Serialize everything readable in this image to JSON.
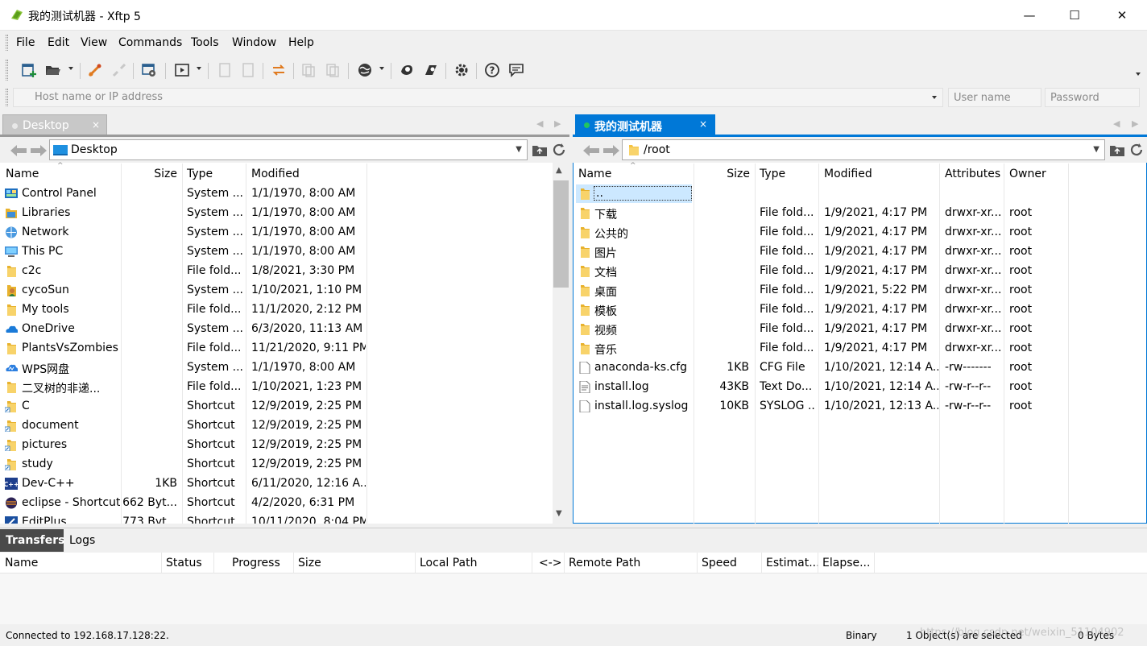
{
  "window": {
    "title": "我的测试机器  - Xftp 5",
    "minimize": "—",
    "maximize": "☐",
    "close": "✕"
  },
  "menu": [
    "File",
    "Edit",
    "View",
    "Commands",
    "Tools",
    "Window",
    "Help"
  ],
  "toolbar_icons": [
    "new-session-icon",
    "open-folder-icon",
    "connect-icon",
    "disconnect-icon",
    "session-properties-icon",
    "transfer-icon",
    "refresh-icon",
    "copy-icon",
    "sync-icon",
    "paste-icon",
    "paste-into-icon",
    "web-icon",
    "xshell-icon",
    "xftp-icon",
    "options-icon",
    "help-icon",
    "feedback-icon"
  ],
  "address": {
    "host_placeholder": "Host name or IP address",
    "user_placeholder": "User name",
    "password_placeholder": "Password"
  },
  "left_pane": {
    "tab": "Desktop",
    "tab_close": "×",
    "path": "Desktop",
    "columns": [
      "Name",
      "Size",
      "Type",
      "Modified"
    ],
    "files": [
      {
        "name": "Control Panel",
        "size": "",
        "type": "System ...",
        "modified": "1/1/1970, 8:00 AM",
        "icon": "control-panel"
      },
      {
        "name": "Libraries",
        "size": "",
        "type": "System ...",
        "modified": "1/1/1970, 8:00 AM",
        "icon": "libraries"
      },
      {
        "name": "Network",
        "size": "",
        "type": "System ...",
        "modified": "1/1/1970, 8:00 AM",
        "icon": "network"
      },
      {
        "name": "This PC",
        "size": "",
        "type": "System ...",
        "modified": "1/1/1970, 8:00 AM",
        "icon": "this-pc"
      },
      {
        "name": "c2c",
        "size": "",
        "type": "File fold...",
        "modified": "1/8/2021, 3:30 PM",
        "icon": "folder"
      },
      {
        "name": "cycoSun",
        "size": "",
        "type": "System ...",
        "modified": "1/10/2021, 1:10 PM",
        "icon": "user-folder"
      },
      {
        "name": "My tools",
        "size": "",
        "type": "File fold...",
        "modified": "11/1/2020, 2:12 PM",
        "icon": "folder"
      },
      {
        "name": "OneDrive",
        "size": "",
        "type": "System ...",
        "modified": "6/3/2020, 11:13 AM",
        "icon": "onedrive"
      },
      {
        "name": "PlantsVsZombies",
        "size": "",
        "type": "File fold...",
        "modified": "11/21/2020, 9:11 PM",
        "icon": "folder"
      },
      {
        "name": "WPS网盘",
        "size": "",
        "type": "System ...",
        "modified": "1/1/1970, 8:00 AM",
        "icon": "wps-cloud"
      },
      {
        "name": "二叉树的非递...",
        "size": "",
        "type": "File fold...",
        "modified": "1/10/2021, 1:23 PM",
        "icon": "folder"
      },
      {
        "name": "C",
        "size": "",
        "type": "Shortcut",
        "modified": "12/9/2019, 2:25 PM",
        "icon": "folder-shortcut"
      },
      {
        "name": "document",
        "size": "",
        "type": "Shortcut",
        "modified": "12/9/2019, 2:25 PM",
        "icon": "folder-shortcut"
      },
      {
        "name": "pictures",
        "size": "",
        "type": "Shortcut",
        "modified": "12/9/2019, 2:25 PM",
        "icon": "folder-shortcut"
      },
      {
        "name": "study",
        "size": "",
        "type": "Shortcut",
        "modified": "12/9/2019, 2:25 PM",
        "icon": "folder-shortcut"
      },
      {
        "name": "Dev-C++",
        "size": "1KB",
        "type": "Shortcut",
        "modified": "6/11/2020, 12:16 A...",
        "icon": "devcpp"
      },
      {
        "name": "eclipse - Shortcut",
        "size": "662 Byt...",
        "type": "Shortcut",
        "modified": "4/2/2020, 6:31 PM",
        "icon": "eclipse"
      },
      {
        "name": "EditPlus",
        "size": "773 Byt...",
        "type": "Shortcut",
        "modified": "10/11/2020, 8:04 PM",
        "icon": "editplus"
      }
    ]
  },
  "right_pane": {
    "tab": "我的测试机器",
    "tab_close": "×",
    "path": "/root",
    "columns": [
      "Name",
      "Size",
      "Type",
      "Modified",
      "Attributes",
      "Owner"
    ],
    "files": [
      {
        "name": "..",
        "size": "",
        "type": "",
        "modified": "",
        "attributes": "",
        "owner": "",
        "icon": "folder"
      },
      {
        "name": "下载",
        "size": "",
        "type": "File fold...",
        "modified": "1/9/2021, 4:17 PM",
        "attributes": "drwxr-xr...",
        "owner": "root",
        "icon": "folder"
      },
      {
        "name": "公共的",
        "size": "",
        "type": "File fold...",
        "modified": "1/9/2021, 4:17 PM",
        "attributes": "drwxr-xr...",
        "owner": "root",
        "icon": "folder"
      },
      {
        "name": "图片",
        "size": "",
        "type": "File fold...",
        "modified": "1/9/2021, 4:17 PM",
        "attributes": "drwxr-xr...",
        "owner": "root",
        "icon": "folder"
      },
      {
        "name": "文档",
        "size": "",
        "type": "File fold...",
        "modified": "1/9/2021, 4:17 PM",
        "attributes": "drwxr-xr...",
        "owner": "root",
        "icon": "folder"
      },
      {
        "name": "桌面",
        "size": "",
        "type": "File fold...",
        "modified": "1/9/2021, 5:22 PM",
        "attributes": "drwxr-xr...",
        "owner": "root",
        "icon": "folder"
      },
      {
        "name": "模板",
        "size": "",
        "type": "File fold...",
        "modified": "1/9/2021, 4:17 PM",
        "attributes": "drwxr-xr...",
        "owner": "root",
        "icon": "folder"
      },
      {
        "name": "视频",
        "size": "",
        "type": "File fold...",
        "modified": "1/9/2021, 4:17 PM",
        "attributes": "drwxr-xr...",
        "owner": "root",
        "icon": "folder"
      },
      {
        "name": "音乐",
        "size": "",
        "type": "File fold...",
        "modified": "1/9/2021, 4:17 PM",
        "attributes": "drwxr-xr...",
        "owner": "root",
        "icon": "folder"
      },
      {
        "name": "anaconda-ks.cfg",
        "size": "1KB",
        "type": "CFG File",
        "modified": "1/10/2021, 12:14 A...",
        "attributes": "-rw-------",
        "owner": "root",
        "icon": "file"
      },
      {
        "name": "install.log",
        "size": "43KB",
        "type": "Text Do...",
        "modified": "1/10/2021, 12:14 A...",
        "attributes": "-rw-r--r--",
        "owner": "root",
        "icon": "textfile"
      },
      {
        "name": "install.log.syslog",
        "size": "10KB",
        "type": "SYSLOG ...",
        "modified": "1/10/2021, 12:13 A...",
        "attributes": "-rw-r--r--",
        "owner": "root",
        "icon": "file"
      }
    ]
  },
  "transfers": {
    "tabs": [
      "Transfers",
      "Logs"
    ],
    "columns": [
      "Name",
      "Status",
      "Progress",
      "Size",
      "Local Path",
      "<->",
      "Remote Path",
      "Speed",
      "Estimat...",
      "Elapse..."
    ]
  },
  "status": {
    "connection": "Connected to 192.168.17.128:22.",
    "mode": "Binary",
    "selection": "1 Object(s) are selected",
    "bytes": "0 Bytes",
    "watermark": "https://blog.csdn.net/weixin_51104902"
  },
  "colors": {
    "accent": "#0078d7",
    "selected_row": "#cce8ff",
    "connected_dot": "#22c55e",
    "folder": "#f5c342"
  }
}
